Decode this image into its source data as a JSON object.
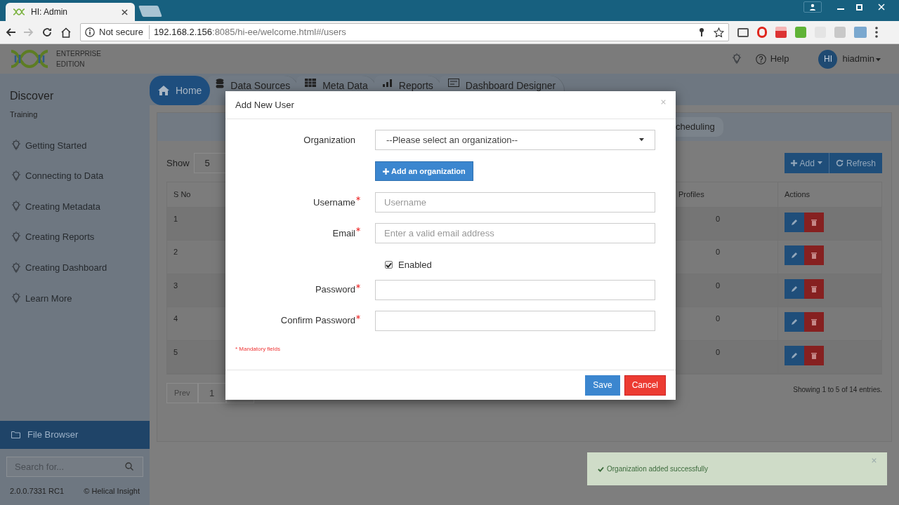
{
  "browser": {
    "tab_title": "HI: Admin",
    "security": "Not secure",
    "url_host": "192.168.2.156",
    "url_rest": ":8085/hi-ee/welcome.html#/users"
  },
  "header": {
    "logo_lines": [
      "ENTERPRISE",
      "EDITION"
    ],
    "help": "Help",
    "user_initials": "HI",
    "user_name": "hiadmin"
  },
  "sidebar": {
    "heading": "Discover",
    "subheading": "Training",
    "items": [
      "Getting Started",
      "Connecting to Data",
      "Creating Metadata",
      "Creating Reports",
      "Creating Dashboard",
      "Learn More"
    ],
    "file_browser": "File Browser",
    "search_placeholder": "Search for...",
    "version": "2.0.0.7331 RC1",
    "copyright": "© Helical Insight"
  },
  "nav_tabs": [
    {
      "label": "Home",
      "selected": true
    },
    {
      "label": "Data Sources",
      "selected": false
    },
    {
      "label": "Meta Data",
      "selected": false
    },
    {
      "label": "Reports",
      "selected": false
    },
    {
      "label": "Dashboard Designer",
      "selected": false
    }
  ],
  "sub_tab": "cheduling",
  "toolbar": {
    "show_label": "Show",
    "show_value": "5",
    "add": "Add",
    "refresh": "Refresh"
  },
  "table": {
    "columns": [
      "S No",
      "Profiles",
      "Actions"
    ],
    "rows": [
      {
        "s_no": "1",
        "profiles": "0"
      },
      {
        "s_no": "2",
        "profiles": "0"
      },
      {
        "s_no": "3",
        "profiles": "0"
      },
      {
        "s_no": "4",
        "profiles": "0"
      },
      {
        "s_no": "5",
        "profiles": "0"
      }
    ]
  },
  "pagination": {
    "prev": "Prev",
    "page": "1",
    "summary": "Showing 1 to 5 of 14 entries."
  },
  "modal": {
    "title": "Add New User",
    "fields": [
      {
        "kind": "select",
        "label": "Organization",
        "value": "--Please select an organization--"
      },
      {
        "kind": "button",
        "label": "Add an organization"
      },
      {
        "kind": "text",
        "label": "Username",
        "required": true,
        "placeholder": "Username"
      },
      {
        "kind": "text",
        "label": "Email",
        "required": true,
        "placeholder": "Enter a valid email address"
      },
      {
        "kind": "checkbox",
        "label": "Enabled",
        "checked": true
      },
      {
        "kind": "text",
        "label": "Password",
        "required": true
      },
      {
        "kind": "text",
        "label": "Confirm Password",
        "required": true
      }
    ],
    "note": "* Mandatory fields",
    "save": "Save",
    "cancel": "Cancel"
  },
  "toast": {
    "message": "Organization added successfully"
  }
}
